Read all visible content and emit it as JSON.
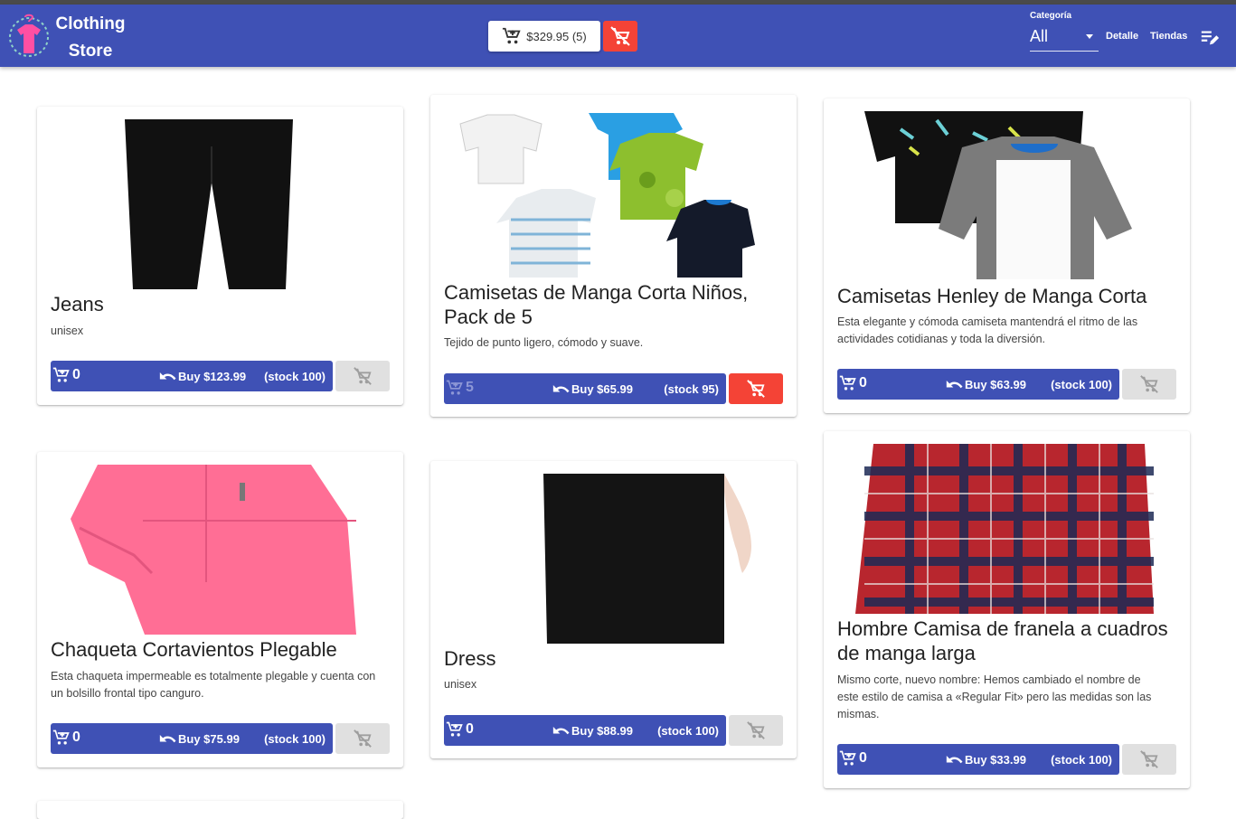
{
  "app": {
    "brand_line1": "Clothing",
    "brand_line2": "Store",
    "cart_total": "$329.95 (5)",
    "category_label": "Categoría",
    "category_value": "All",
    "nav_detalle": "Detalle",
    "nav_tiendas": "Tiendas"
  },
  "colors": {
    "primary": "#3f51b5",
    "danger": "#f44336",
    "disabled": "#e0e0e0"
  },
  "products": [
    {
      "title": "Jeans",
      "desc": "unisex",
      "qty": "0",
      "buy": "Buy $123.99",
      "stock": "(stock 100)"
    },
    {
      "title": "Camisetas de Manga Corta Niños, Pack de 5",
      "desc": "Tejido de punto ligero, cómodo y suave.",
      "qty": "5",
      "buy": "Buy $65.99",
      "stock": "(stock 95)"
    },
    {
      "title": "Camisetas Henley de Manga Corta",
      "desc": "Esta elegante y cómoda camiseta mantendrá el ritmo de las actividades cotidianas y toda la diversión.",
      "qty": "0",
      "buy": "Buy $63.99",
      "stock": "(stock 100)"
    },
    {
      "title": "Chaqueta Cortavientos Plegable",
      "desc": "Esta chaqueta impermeable es totalmente plegable y cuenta con un bolsillo frontal tipo canguro.",
      "qty": "0",
      "buy": "Buy $75.99",
      "stock": "(stock 100)"
    },
    {
      "title": "Dress",
      "desc": "unisex",
      "qty": "0",
      "buy": "Buy $88.99",
      "stock": "(stock 100)"
    },
    {
      "title": "Hombre Camisa de franela a cuadros de manga larga",
      "desc": "Mismo corte, nuevo nombre: Hemos cambiado el nombre de este estilo de camisa a «Regular Fit» pero las medidas son las mismas.",
      "qty": "0",
      "buy": "Buy $33.99",
      "stock": "(stock 100)"
    }
  ]
}
